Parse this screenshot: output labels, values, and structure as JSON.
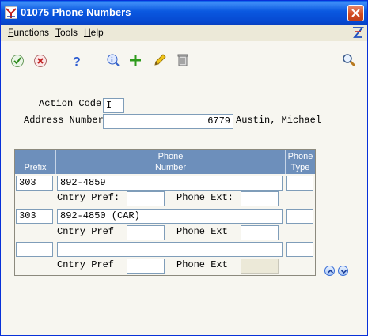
{
  "window": {
    "title": "01075   Phone Numbers"
  },
  "menu": {
    "items": [
      {
        "underline": "F",
        "rest": "unctions"
      },
      {
        "underline": "T",
        "rest": "ools"
      },
      {
        "underline": "H",
        "rest": "elp"
      }
    ]
  },
  "toolbar": {
    "icons": [
      "ok-check-icon",
      "cancel-x-icon",
      "help-question-icon",
      "info-icon",
      "add-plus-icon",
      "edit-pencil-icon",
      "delete-trash-icon",
      "search-magnifier-icon"
    ]
  },
  "form": {
    "action_code_label": "Action Code",
    "action_code_value": "I",
    "address_number_label": "Address Number",
    "address_number_value": "6779",
    "address_name": "Austin, Michael"
  },
  "grid": {
    "columns": {
      "prefix": "Prefix",
      "phone_number_line1": "Phone",
      "phone_number_line2": "Number",
      "phone_type_line1": "Phone",
      "phone_type_line2": "Type"
    },
    "rows": [
      {
        "prefix": "303",
        "number": "892-4859",
        "type": "",
        "cntry_label": "Cntry Pref:",
        "cntry_value": "",
        "ext_label": "Phone Ext:",
        "ext_value": ""
      },
      {
        "prefix": "303",
        "number": "892-4850 (CAR)",
        "type": "",
        "cntry_label": "Cntry Pref",
        "cntry_value": "",
        "ext_label": "Phone Ext",
        "ext_value": ""
      },
      {
        "prefix": "",
        "number": "",
        "type": "",
        "cntry_label": "Cntry Pref",
        "cntry_value": "",
        "ext_label": "Phone Ext",
        "ext_value": ""
      }
    ]
  },
  "colors": {
    "title_bar": "#0a58e0",
    "grid_header": "#6d8fbb",
    "field_border": "#7f9db9"
  }
}
